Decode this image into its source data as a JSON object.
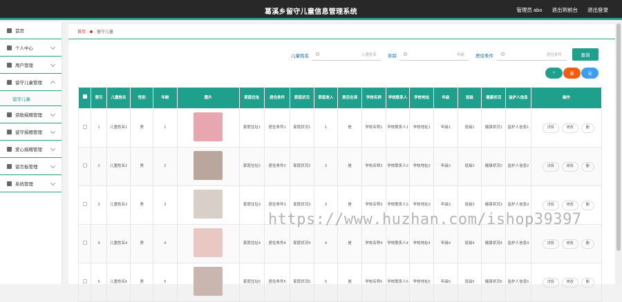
{
  "header": {
    "title": "葛溪乡留守儿童信息管理系统",
    "links": [
      "管理员 abo",
      "退出到前台",
      "退出登录"
    ]
  },
  "sidebar": {
    "items": [
      {
        "label": "首页",
        "icon": "home-icon"
      },
      {
        "label": "个人中心",
        "icon": "user-icon"
      },
      {
        "label": "用户管理",
        "icon": "users-icon"
      },
      {
        "label": "留守儿童管理",
        "icon": "child-icon"
      },
      {
        "label": "资助捐赠管理",
        "icon": "donate-icon"
      },
      {
        "label": "留守捐赠管理",
        "icon": "gift-icon"
      },
      {
        "label": "爱心捐赠管理",
        "icon": "heart-icon"
      },
      {
        "label": "留言板管理",
        "icon": "message-icon"
      },
      {
        "label": "系统管理",
        "icon": "settings-icon"
      }
    ],
    "submenu": "留守儿童"
  },
  "breadcrumb": {
    "home": "首页",
    "current": "留守儿童"
  },
  "search": {
    "name_label": "儿童姓名",
    "name_placeholder": "儿童姓名",
    "age_label": "年龄",
    "age_placeholder": "年龄",
    "condition_label": "居住条件",
    "condition_placeholder": "居住条件",
    "query_button": "查询"
  },
  "actions": {
    "add": "+",
    "delete": "删",
    "export": "导"
  },
  "table": {
    "headers": [
      "索引",
      "儿童姓名",
      "性别",
      "年龄",
      "图片",
      "家庭住址",
      "居住条件",
      "家庭状况",
      "家庭收入",
      "是否在读",
      "学校名称",
      "学校联系人",
      "学校地址",
      "年级",
      "班级",
      "健康状况",
      "监护人信息",
      "操作"
    ],
    "rows": [
      {
        "index": "1",
        "name": "儿童姓名1",
        "gender": "男",
        "age": "1",
        "address": "家庭住址1",
        "living": "居住条件1",
        "family": "家庭状况1",
        "income": "1",
        "studying": "是",
        "school": "学校名称1",
        "contact": "学校联系人1",
        "school_addr": "学校地址1",
        "grade": "年级1",
        "class": "班级1",
        "health": "健康状况1",
        "guardian": "监护人信息1",
        "photo_color": "#e8a7b0"
      },
      {
        "index": "2",
        "name": "儿童姓名2",
        "gender": "男",
        "age": "2",
        "address": "家庭住址2",
        "living": "居住条件2",
        "family": "家庭状况2",
        "income": "2",
        "studying": "是",
        "school": "学校名称2",
        "contact": "学校联系人2",
        "school_addr": "学校地址2",
        "grade": "年级2",
        "class": "班级2",
        "health": "健康状况2",
        "guardian": "监护人信息2",
        "photo_color": "#b9a69c"
      },
      {
        "index": "3",
        "name": "儿童姓名3",
        "gender": "男",
        "age": "3",
        "address": "家庭住址3",
        "living": "居住条件3",
        "family": "家庭状况3",
        "income": "3",
        "studying": "是",
        "school": "学校名称3",
        "contact": "学校联系人3",
        "school_addr": "学校地址3",
        "grade": "年级3",
        "class": "班级3",
        "health": "健康状况3",
        "guardian": "监护人信息3",
        "photo_color": "#d7cfc8"
      },
      {
        "index": "4",
        "name": "儿童姓名4",
        "gender": "男",
        "age": "4",
        "address": "家庭住址4",
        "living": "居住条件4",
        "family": "家庭状况4",
        "income": "4",
        "studying": "是",
        "school": "学校名称4",
        "contact": "学校联系人4",
        "school_addr": "学校地址4",
        "grade": "年级4",
        "class": "班级4",
        "health": "健康状况4",
        "guardian": "监护人信息4",
        "photo_color": "#e9c8c4"
      },
      {
        "index": "5",
        "name": "儿童姓名5",
        "gender": "男",
        "age": "5",
        "address": "家庭住址5",
        "living": "居住条件5",
        "family": "家庭状况5",
        "income": "5",
        "studying": "是",
        "school": "学校名称5",
        "contact": "学校联系人5",
        "school_addr": "学校地址5",
        "grade": "年级5",
        "class": "班级5",
        "health": "健康状况5",
        "guardian": "监护人信息5",
        "photo_color": "#c9b6ae"
      }
    ],
    "op_labels": [
      "详情",
      "修改",
      "删"
    ]
  },
  "watermark": "https://www.huzhan.com/ishop39397",
  "colors": {
    "accent": "#1fa08d",
    "topbar": "#282828",
    "add": "#1fa08d",
    "delete": "#f45b0f",
    "export": "#3d9df0"
  }
}
